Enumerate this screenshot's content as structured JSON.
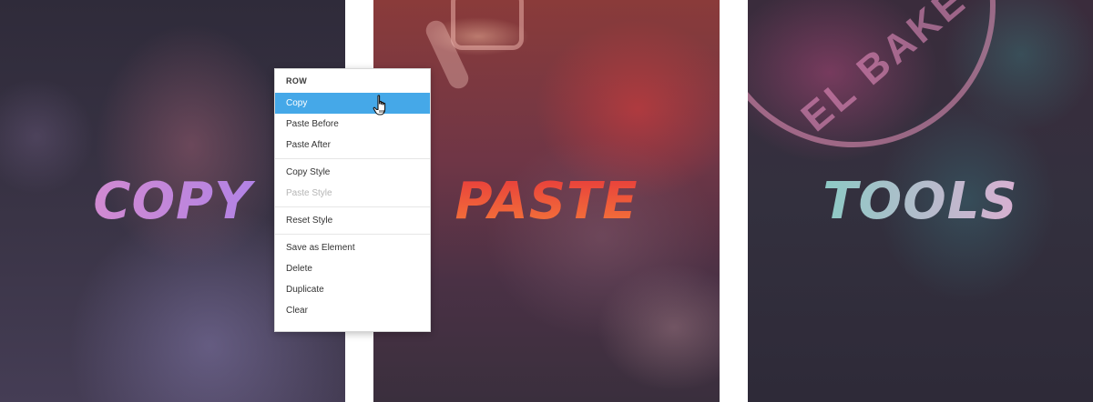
{
  "panels": [
    {
      "word": "COPY",
      "gradient": [
        "#e38ec6",
        "#a07ff0"
      ]
    },
    {
      "word": "PASTE",
      "gradient": [
        "#e83b3b",
        "#f4793a"
      ]
    },
    {
      "word": "TOOLS",
      "gradient": [
        "#6fd3c0",
        "#f6a6d6"
      ],
      "neon_sign_text": "EL BAKE"
    }
  ],
  "context_menu": {
    "header": "ROW",
    "items": [
      {
        "label": "Copy",
        "state": "highlighted"
      },
      {
        "label": "Paste Before"
      },
      {
        "label": "Paste After"
      },
      {
        "label": "Copy Style"
      },
      {
        "label": "Paste Style",
        "state": "disabled"
      },
      {
        "label": "Reset Style"
      },
      {
        "label": "Save as Element"
      },
      {
        "label": "Delete"
      },
      {
        "label": "Duplicate"
      },
      {
        "label": "Clear"
      }
    ],
    "highlight_color": "#45a8e8"
  },
  "cursor": {
    "icon": "hand-pointer-icon"
  }
}
